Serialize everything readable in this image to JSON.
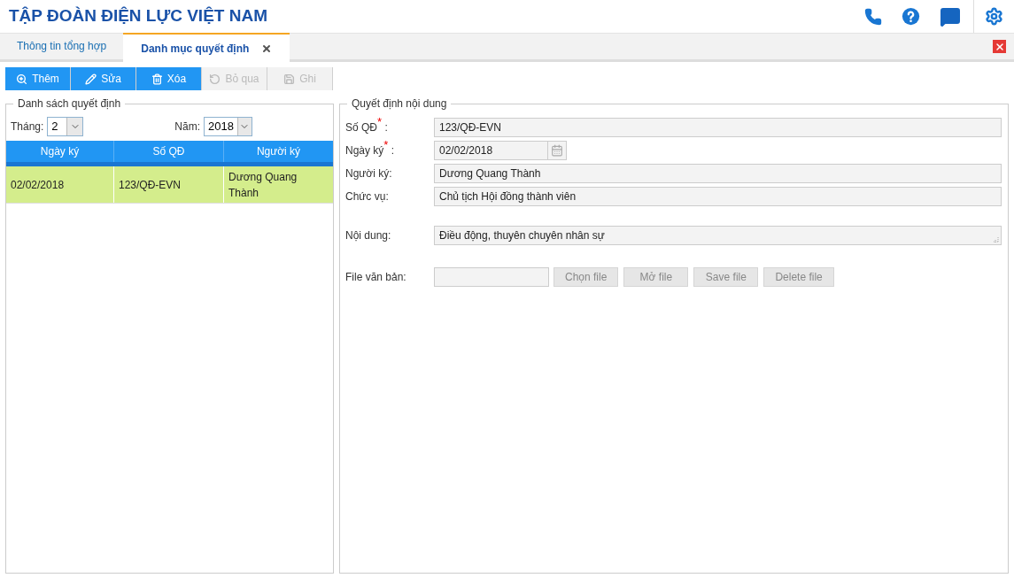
{
  "header": {
    "title": "TẬP ĐOÀN ĐIỆN LỰC VIỆT NAM"
  },
  "tabs": [
    {
      "label": "Thông tin tổng hợp",
      "selected": false,
      "closable": false
    },
    {
      "label": "Danh mục quyết định",
      "selected": true,
      "closable": true
    }
  ],
  "toolbar": [
    {
      "kind": "add",
      "label": "Thêm",
      "disabled": false
    },
    {
      "kind": "edit",
      "label": "Sửa",
      "disabled": false
    },
    {
      "kind": "delete",
      "label": "Xóa",
      "disabled": false
    },
    {
      "kind": "undo",
      "label": "Bỏ qua",
      "disabled": true
    },
    {
      "kind": "save",
      "label": "Ghi",
      "disabled": true
    }
  ],
  "list_panel": {
    "legend": "Danh sách quyết định",
    "month": {
      "label": "Tháng:",
      "value": "2"
    },
    "year": {
      "label": "Năm:",
      "value": "2018"
    },
    "columns": [
      "Ngày ký",
      "Số QĐ",
      "Người ký"
    ],
    "rows": [
      {
        "cells": [
          "02/02/2018",
          "123/QĐ-EVN",
          "Dương Quang Thành"
        ],
        "selected": true
      }
    ]
  },
  "detail_panel": {
    "legend": "Quyết định nội dung",
    "fields": [
      {
        "kind": "text",
        "label": "Số QĐ$^{*}$ :",
        "value": "123/QĐ-EVN"
      },
      {
        "kind": "date",
        "label": "Ngày ký$^{*}$ :",
        "value": "02/02/2018"
      },
      {
        "kind": "text",
        "label": "Người ký:",
        "value": "Dương Quang Thành"
      },
      {
        "kind": "text",
        "label": "Chức vụ:",
        "value": "Chủ tịch Hội đồng thành viên"
      },
      {
        "kind": "textarea",
        "label": "Nội dung:",
        "value": "Điều động, thuyên chuyên nhân sự"
      }
    ],
    "file": {
      "label": "File văn bản:",
      "buttons": [
        "Chọn file",
        "Mở file",
        "Save file",
        "Delete file"
      ]
    }
  }
}
